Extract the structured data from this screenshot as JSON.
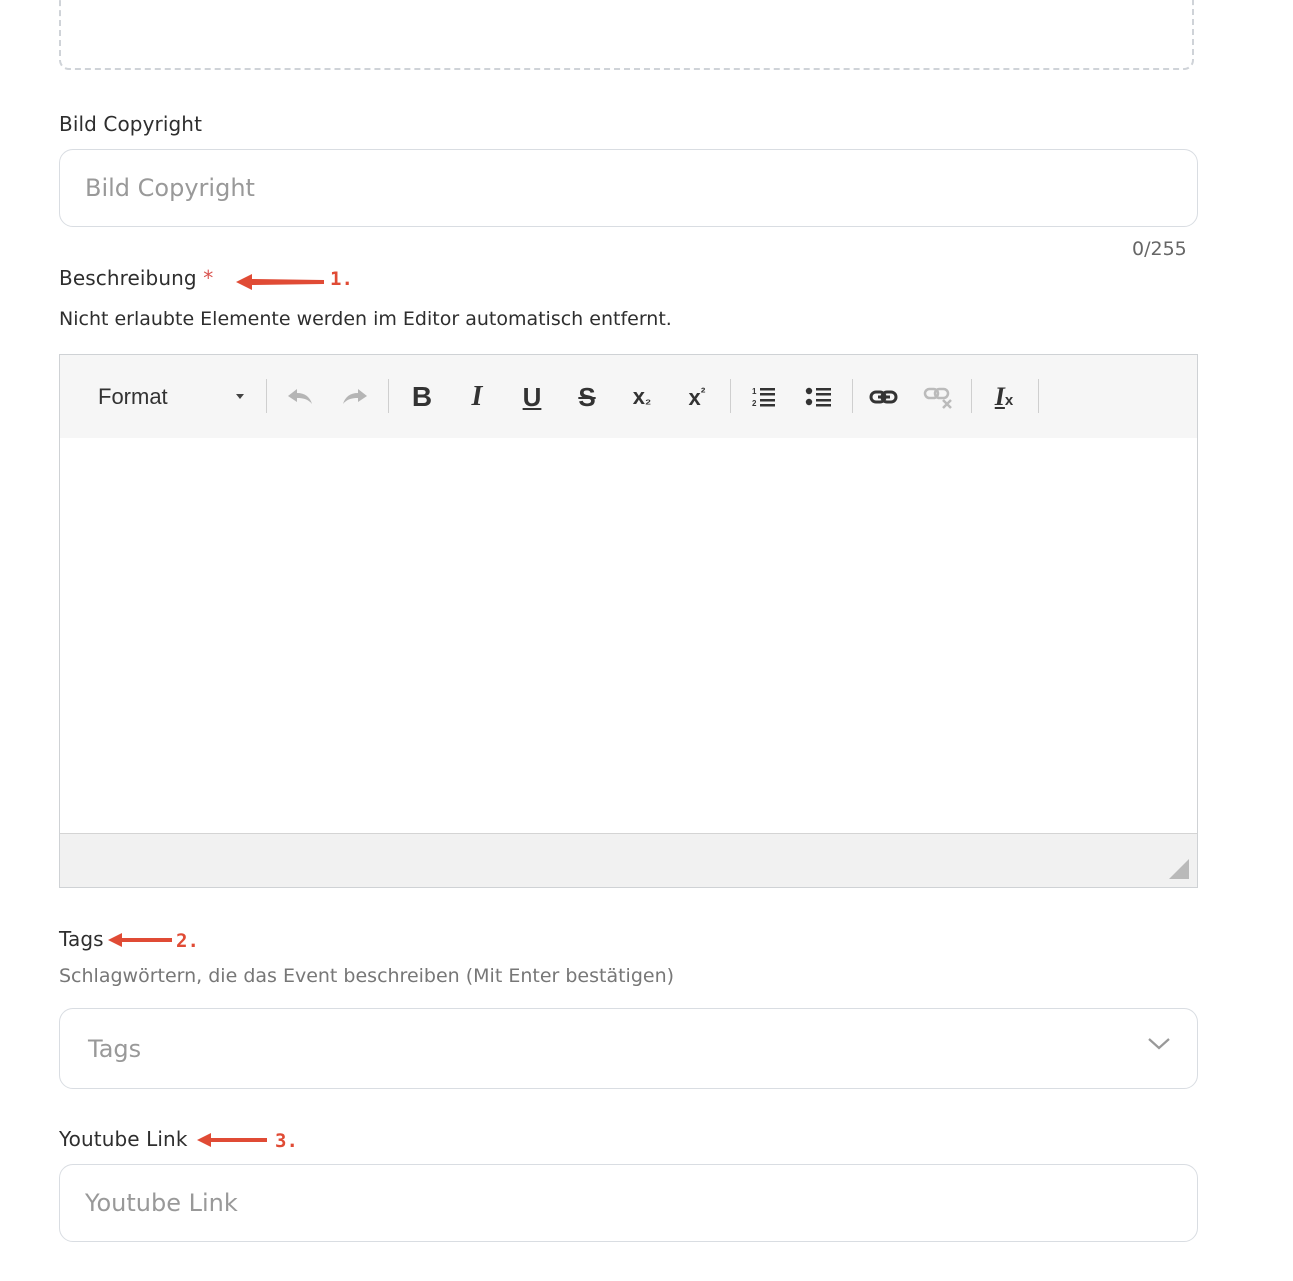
{
  "bild_copyright": {
    "label": "Bild Copyright",
    "placeholder": "Bild Copyright",
    "counter": "0/255"
  },
  "beschreibung": {
    "label": "Beschreibung",
    "required_mark": "*",
    "note": "Nicht erlaubte Elemente werden im Editor automatisch entfernt.",
    "toolbar": {
      "format_label": "Format",
      "buttons": [
        "undo-icon",
        "redo-icon",
        "bold-icon",
        "italic-icon",
        "underline-icon",
        "strikethrough-icon",
        "subscript-icon",
        "superscript-icon",
        "numbered-list-icon",
        "bulleted-list-icon",
        "link-icon",
        "unlink-icon",
        "remove-format-icon"
      ],
      "bold": "B",
      "italic": "I",
      "underline": "U",
      "strike": "S",
      "subscript_base": "x",
      "subscript_sub": "₂",
      "superscript_base": "x",
      "superscript_sup": "²",
      "clear_base": "I",
      "clear_x": "x"
    }
  },
  "tags": {
    "label": "Tags",
    "hint": "Schlagwörtern, die das Event beschreiben (Mit Enter bestätigen)",
    "placeholder": "Tags"
  },
  "youtube": {
    "label": "Youtube Link",
    "placeholder": "Youtube Link"
  },
  "annotations": [
    "1.",
    "2.",
    "3."
  ],
  "colors": {
    "annotation": "#e04b35",
    "required": "#d9534f",
    "border": "#d9dde2"
  }
}
